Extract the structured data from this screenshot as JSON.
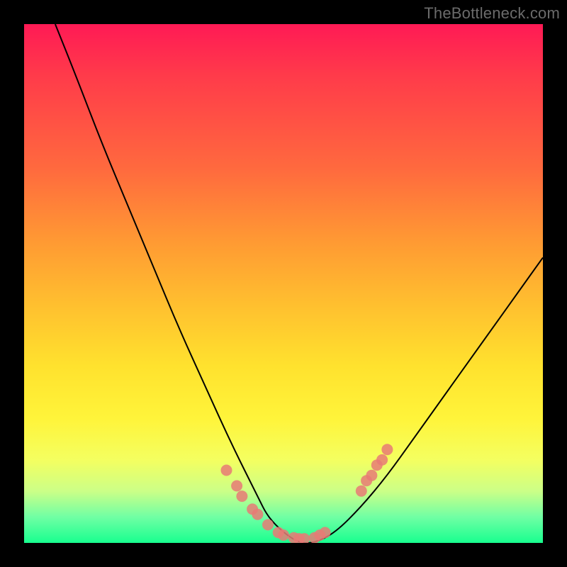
{
  "watermark": "TheBottleneck.com",
  "chart_data": {
    "type": "line",
    "title": "",
    "xlabel": "",
    "ylabel": "",
    "xlim": [
      0,
      100
    ],
    "ylim": [
      0,
      100
    ],
    "series": [
      {
        "name": "bottleneck-curve",
        "x": [
          6,
          10,
          15,
          20,
          25,
          30,
          35,
          40,
          45,
          47,
          50,
          53,
          56,
          60,
          65,
          70,
          75,
          80,
          85,
          90,
          95,
          100
        ],
        "y": [
          100,
          90,
          77,
          65,
          53,
          41,
          30,
          19,
          9,
          5,
          2,
          0,
          0,
          2,
          7,
          13,
          20,
          27,
          34,
          41,
          48,
          55
        ]
      }
    ],
    "markers": {
      "name": "salmon-dots",
      "color": "#e77a76",
      "points": [
        {
          "x": 39,
          "y": 14
        },
        {
          "x": 41,
          "y": 11
        },
        {
          "x": 42,
          "y": 9
        },
        {
          "x": 44,
          "y": 6.5
        },
        {
          "x": 45,
          "y": 5.5
        },
        {
          "x": 47,
          "y": 3.5
        },
        {
          "x": 49,
          "y": 2
        },
        {
          "x": 50,
          "y": 1.5
        },
        {
          "x": 52,
          "y": 1
        },
        {
          "x": 53,
          "y": 0.8
        },
        {
          "x": 54,
          "y": 0.8
        },
        {
          "x": 56,
          "y": 1
        },
        {
          "x": 57,
          "y": 1.5
        },
        {
          "x": 58,
          "y": 2
        },
        {
          "x": 65,
          "y": 10
        },
        {
          "x": 66,
          "y": 12
        },
        {
          "x": 67,
          "y": 13
        },
        {
          "x": 68,
          "y": 15
        },
        {
          "x": 69,
          "y": 16
        },
        {
          "x": 70,
          "y": 18
        }
      ]
    },
    "colors": {
      "curve": "#000000",
      "marker": "#e77a76",
      "gradient_top": "#ff1a55",
      "gradient_bottom": "#18ff8f"
    }
  }
}
